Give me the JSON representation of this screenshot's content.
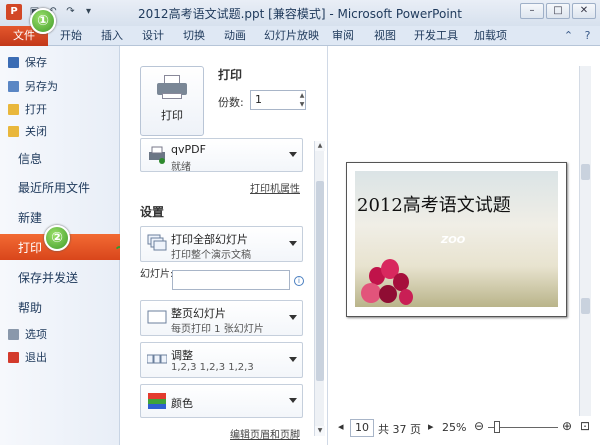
{
  "titlebar": {
    "app_icon": "P",
    "title": "2012高考语文试题.ppt [兼容模式] - Microsoft PowerPoint",
    "window_controls": [
      "–",
      "□",
      "✕"
    ]
  },
  "ribbon": {
    "tabs": [
      "文件",
      "开始",
      "插入",
      "设计",
      "切换",
      "动画",
      "幻灯片放映",
      "审阅",
      "视图",
      "开发工具",
      "加载项"
    ]
  },
  "nav": {
    "save": "保存",
    "save_as": "另存为",
    "open": "打开",
    "close": "关闭",
    "info": "信息",
    "recent": "最近所用文件",
    "new": "新建",
    "print": "打印",
    "save_send": "保存并发送",
    "help": "帮助",
    "options": "选项",
    "exit": "退出"
  },
  "badges": {
    "one": "①",
    "two": "②"
  },
  "print_panel": {
    "heading": "打印",
    "print_button": "打印",
    "copies_label": "份数:",
    "copies_value": "1",
    "printer_name": "qvPDF",
    "printer_status": "就绪",
    "printer_props": "打印机属性",
    "settings_heading": "设置",
    "range_title": "打印全部幻灯片",
    "range_desc": "打印整个演示文稿",
    "slides_label": "幻灯片:",
    "layout_title": "整页幻灯片",
    "layout_desc": "每页打印 1 张幻灯片",
    "collate_title": "调整",
    "collate_desc": "1,2,3    1,2,3    1,2,3",
    "color_title": "颜色",
    "edit_header_footer": "编辑页眉和页脚"
  },
  "preview": {
    "slide_title": "2012高考语文试题",
    "logo_text": "ZOO",
    "page_value": "10",
    "page_total": "共 37 页",
    "zoom": "25%"
  }
}
